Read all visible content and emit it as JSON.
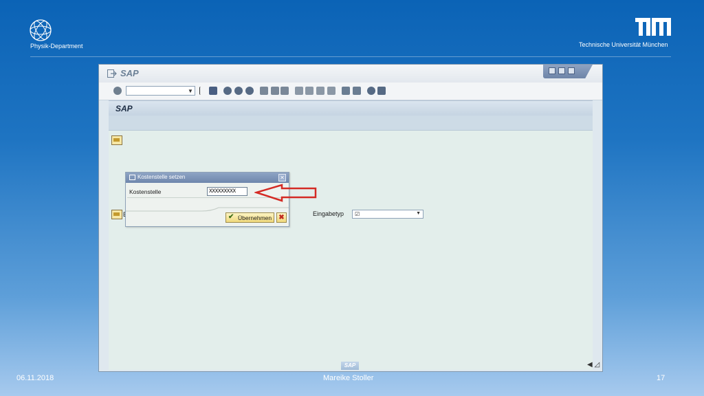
{
  "slide": {
    "department": "Physik-Department",
    "university": "Technische Universität München",
    "tum_logo_text": "TUM",
    "footer": {
      "date": "06.11.2018",
      "author": "Mareike Stoller",
      "page": "17"
    }
  },
  "sap": {
    "window_title": "SAP",
    "content_title": "SAP",
    "command_field_value": "",
    "eingabetyp_label": "Eingabetyp",
    "eingabetyp_value": "",
    "hidden_field_label_initial": "E",
    "status_logo": "SAP",
    "toolbar_icons": [
      "enter-icon",
      "back-icon",
      "save-icon",
      "back-nav-icon",
      "exit-icon",
      "cancel-icon",
      "print-icon",
      "find-icon",
      "find-next-icon",
      "first-page-icon",
      "prev-page-icon",
      "next-page-icon",
      "last-page-icon",
      "create-session-icon",
      "shortcut-icon",
      "help-icon",
      "layout-icon"
    ]
  },
  "dialog": {
    "title": "Kostenstelle setzen",
    "field_label": "Kostenstelle",
    "field_value": "XXXXXXXXX",
    "accept_label": "Übernehmen",
    "close_glyph": "✕",
    "cancel_glyph": "✖"
  },
  "colors": {
    "arrow": "#d42a24",
    "slide_blue": "#0b63b6"
  }
}
